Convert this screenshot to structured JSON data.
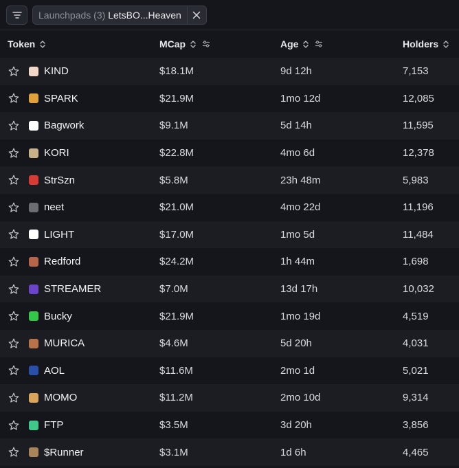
{
  "filter": {
    "chip_key": "Launchpads (3)",
    "chip_value": "LetsBO...Heaven"
  },
  "columns": {
    "token": "Token",
    "mcap": "MCap",
    "age": "Age",
    "holders": "Holders"
  },
  "rows": [
    {
      "name": "KIND",
      "mcap": "$18.1M",
      "age": "9d 12h",
      "holders": "7,153",
      "logo_color": "#f3d7c6",
      "logo_icon": "heart-icon"
    },
    {
      "name": "SPARK",
      "mcap": "$21.9M",
      "age": "1mo 12d",
      "holders": "12,085",
      "logo_color": "#e0a03a",
      "logo_icon": "spark-logo-icon"
    },
    {
      "name": "Bagwork",
      "mcap": "$9.1M",
      "age": "5d 14h",
      "holders": "11,595",
      "logo_color": "#ffffff",
      "logo_icon": "bagwork-logo-icon"
    },
    {
      "name": "KORI",
      "mcap": "$22.8M",
      "age": "4mo 6d",
      "holders": "12,378",
      "logo_color": "#c9b28a",
      "logo_icon": "kori-logo-icon"
    },
    {
      "name": "StrSzn",
      "mcap": "$5.8M",
      "age": "23h 48m",
      "holders": "5,983",
      "logo_color": "#d83a34",
      "logo_icon": "strszn-logo-icon"
    },
    {
      "name": "neet",
      "mcap": "$21.0M",
      "age": "4mo 22d",
      "holders": "11,196",
      "logo_color": "#6b6d72",
      "logo_icon": "neet-logo-icon"
    },
    {
      "name": "LIGHT",
      "mcap": "$17.0M",
      "age": "1mo 5d",
      "holders": "11,484",
      "logo_color": "#ffffff",
      "logo_icon": "light-logo-icon"
    },
    {
      "name": "Redford",
      "mcap": "$24.2M",
      "age": "1h 44m",
      "holders": "1,698",
      "logo_color": "#b5654a",
      "logo_icon": "redford-logo-icon"
    },
    {
      "name": "STREAMER",
      "mcap": "$7.0M",
      "age": "13d 17h",
      "holders": "10,032",
      "logo_color": "#6a44c9",
      "logo_icon": "streamer-logo-icon"
    },
    {
      "name": "Bucky",
      "mcap": "$21.9M",
      "age": "1mo 19d",
      "holders": "4,519",
      "logo_color": "#33c64a",
      "logo_icon": "bucky-logo-icon"
    },
    {
      "name": "MURICA",
      "mcap": "$4.6M",
      "age": "5d 20h",
      "holders": "4,031",
      "logo_color": "#b8734a",
      "logo_icon": "murica-logo-icon"
    },
    {
      "name": "AOL",
      "mcap": "$11.6M",
      "age": "2mo 1d",
      "holders": "5,021",
      "logo_color": "#2a4fa8",
      "logo_icon": "aol-logo-icon"
    },
    {
      "name": "MOMO",
      "mcap": "$11.2M",
      "age": "2mo 10d",
      "holders": "9,314",
      "logo_color": "#d9a55c",
      "logo_icon": "momo-logo-icon"
    },
    {
      "name": "FTP",
      "mcap": "$3.5M",
      "age": "3d 20h",
      "holders": "3,856",
      "logo_color": "#3ec98a",
      "logo_icon": "ftp-logo-icon"
    },
    {
      "name": "$Runner",
      "mcap": "$3.1M",
      "age": "1d 6h",
      "holders": "4,465",
      "logo_color": "#a8845a",
      "logo_icon": "runner-logo-icon"
    }
  ]
}
